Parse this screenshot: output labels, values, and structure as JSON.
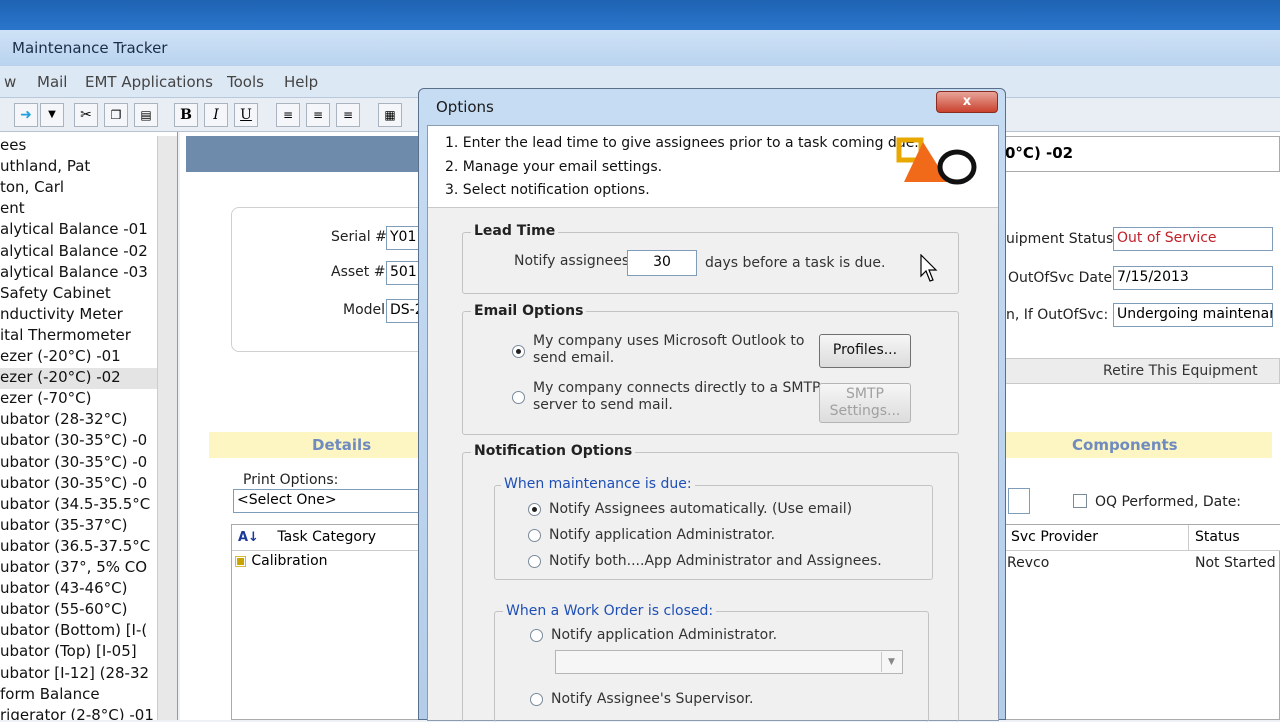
{
  "app": {
    "title": "Maintenance Tracker"
  },
  "menu": [
    "w",
    "Mail",
    "EMT Applications",
    "Tools",
    "Help"
  ],
  "toolbar": {
    "bold": "B",
    "italic": "I",
    "underline": "U"
  },
  "equipment_list": [
    "ees",
    "uthland, Pat",
    "ton, Carl",
    "ent",
    "alytical Balance -01",
    "alytical Balance -02",
    "alytical Balance -03",
    "Safety Cabinet",
    "nductivity Meter",
    "ital Thermometer",
    "ezer (-20°C) -01",
    "ezer (-20°C) -02",
    "ezer (-70°C)",
    "ubator (28-32°C)",
    "ubator (30-35°C) -0",
    "ubator (30-35°C) -0",
    "ubator (30-35°C) -0",
    "ubator (34.5-35.5°C",
    "ubator (35-37°C)",
    "ubator (36.5-37.5°C",
    "ubator (37°, 5% CO",
    "ubator (43-46°C)",
    "ubator (55-60°C)",
    "ubator (Bottom) [I-(",
    "ubator (Top) [I-05]",
    "ubator [I-12] (28-32",
    "form Balance",
    "rigerator (2-8°C) -01"
  ],
  "equipment_selected_index": 11,
  "detail": {
    "header_suffix": "0°C) -02",
    "serial_label": "Serial #:",
    "serial_value": "Y01",
    "asset_label": "Asset #:",
    "asset_value": "501",
    "model_label": "Model:",
    "model_value": "DS-2",
    "status_label": "uipment Status:",
    "status_value": "Out of Service",
    "outofsvc_label": "OutOfSvc Date:",
    "outofsvc_value": "7/15/2013",
    "reason_label": "n, If OutOfSvc:",
    "reason_value": "Undergoing maintenance",
    "retire_label": "Retire This Equipment",
    "details_tab": "Details",
    "components_tab": "Components",
    "print_options_label": "Print Options:",
    "print_options_value": "<Select One>",
    "oq_label": "OQ Performed, Date:",
    "task_col": "Task Category",
    "task_row": "Calibration",
    "svc_col": "Svc Provider",
    "status_col": "Status",
    "svc_row": "Revco",
    "status_row": "Not Started"
  },
  "dialog": {
    "title": "Options",
    "close": "x",
    "intro": [
      "1. Enter the lead time to give assignees prior to a task coming due.",
      "2. Manage your email settings.",
      "3. Select notification options."
    ],
    "lead_time": {
      "title": "Lead Time",
      "prefix": "Notify assignees",
      "value": "30",
      "suffix": "days before a task is due."
    },
    "email_options": {
      "title": "Email Options",
      "outlook_line1": "My company uses Microsoft Outlook to",
      "outlook_line2": "send email.",
      "smtp_line1": "My company connects directly to a SMTP",
      "smtp_line2": "server to send mail.",
      "profiles_button": "Profiles...",
      "smtp_button_line1": "SMTP",
      "smtp_button_line2": "Settings..."
    },
    "notification_options": {
      "title": "Notification Options",
      "due_group_title": "When maintenance is due:",
      "due_options": [
        "Notify Assignees automatically. (Use email)",
        "Notify application Administrator.",
        "Notify both....App Administrator and Assignees."
      ],
      "due_selected_index": 0,
      "closed_group_title": "When a Work Order is closed:",
      "closed_options": [
        "Notify application Administrator.",
        "Notify Assignee's Supervisor."
      ]
    }
  }
}
